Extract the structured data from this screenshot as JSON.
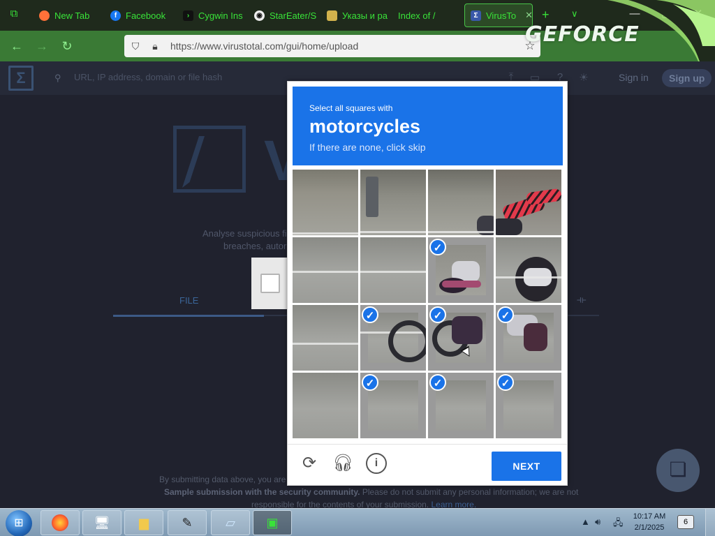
{
  "browser": {
    "tabs": [
      {
        "label": "New Tab",
        "icon": "firefox-icon",
        "color": "#ff7139"
      },
      {
        "label": "Facebook",
        "icon": "facebook-icon",
        "color": "#1877f2"
      },
      {
        "label": "Cygwin Ins",
        "icon": "cygwin-icon",
        "color": "#222"
      },
      {
        "label": "StarEater/S",
        "icon": "github-icon",
        "color": "#eee"
      },
      {
        "label": "Указы и ра",
        "icon": "coat-of-arms-icon",
        "color": "#d2b24c"
      },
      {
        "label": "Index of /",
        "icon": "",
        "color": ""
      },
      {
        "label": "VirusTo",
        "icon": "virustotal-icon",
        "color": "#3a58a8"
      }
    ],
    "url": "https://www.virustotal.com/gui/home/upload",
    "overlay_brand": "GEFORCE"
  },
  "site": {
    "search_placeholder": "URL, IP address, domain or file hash",
    "sign_in": "Sign in",
    "sign_up": "Sign up",
    "hero_brand_partial": "V",
    "desc_line1": "Analyse suspicious fil",
    "desc_line2": "breaches, autor",
    "file_tab": "FILE",
    "footer_line1": "By submitting data above, you are ag",
    "footer_line2_bold": "Sample submission with the security community.",
    "footer_line2_rest": " Please do not submit any personal information; we are not",
    "footer_line3": "responsible for the contents of your submission.",
    "footer_link": "Learn more."
  },
  "captcha": {
    "instruction": "Select all squares with",
    "target": "motorcycles",
    "hint": "If there are none, click skip",
    "selected_tiles": [
      6,
      9,
      10,
      11,
      13,
      14,
      15
    ],
    "next_label": "NEXT",
    "accent": "#1a73e8"
  },
  "taskbar": {
    "time": "10:17 AM",
    "date": "2/1/2025",
    "notifications": "6"
  }
}
